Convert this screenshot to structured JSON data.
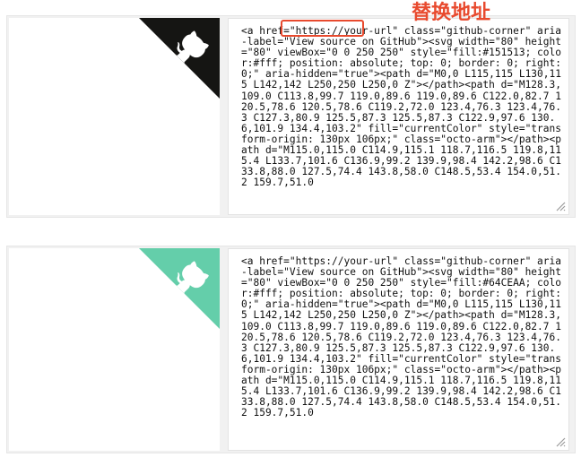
{
  "annotation": {
    "label": "替换地址",
    "color": "#e84a2e"
  },
  "examples": [
    {
      "fill_color": "#151513",
      "icon": "github-octocat-icon",
      "code": "<a href=\"https://your-url\" class=\"github-corner\" aria-label=\"View source on GitHub\"><svg width=\"80\" height=\"80\" viewBox=\"0 0 250 250\" style=\"fill:#151513; color:#fff; position: absolute; top: 0; border: 0; right: 0;\" aria-hidden=\"true\"><path d=\"M0,0 L115,115 L130,115 L142,142 L250,250 L250,0 Z\"></path><path d=\"M128.3,109.0 C113.8,99.7 119.0,89.6 119.0,89.6 C122.0,82.7 120.5,78.6 120.5,78.6 C119.2,72.0 123.4,76.3 123.4,76.3 C127.3,80.9 125.5,87.3 125.5,87.3 C122.9,97.6 130.6,101.9 134.4,103.2\" fill=\"currentColor\" style=\"transform-origin: 130px 106px;\" class=\"octo-arm\"></path><path d=\"M115.0,115.0 C114.9,115.1 118.7,116.5 119.8,115.4 L133.7,101.6 C136.9,99.2 139.9,98.4 142.2,98.6 C133.8,88.0 127.5,74.4 143.8,58.0 C148.5,53.4 154.0,51.2 159.7,51.0"
    },
    {
      "fill_color": "#64CEAA",
      "icon": "github-octocat-icon",
      "code": "<a href=\"https://your-url\" class=\"github-corner\" aria-label=\"View source on GitHub\"><svg width=\"80\" height=\"80\" viewBox=\"0 0 250 250\" style=\"fill:#64CEAA; color:#fff; position: absolute; top: 0; border: 0; right: 0;\" aria-hidden=\"true\"><path d=\"M0,0 L115,115 L130,115 L142,142 L250,250 L250,0 Z\"></path><path d=\"M128.3,109.0 C113.8,99.7 119.0,89.6 119.0,89.6 C122.0,82.7 120.5,78.6 120.5,78.6 C119.2,72.0 123.4,76.3 123.4,76.3 C127.3,80.9 125.5,87.3 125.5,87.3 C122.9,97.6 130.6,101.9 134.4,103.2\" fill=\"currentColor\" style=\"transform-origin: 130px 106px;\" class=\"octo-arm\"></path><path d=\"M115.0,115.0 C114.9,115.1 118.7,116.5 119.8,115.4 L133.7,101.6 C136.9,99.2 139.9,98.4 142.2,98.6 C133.8,88.0 127.5,74.4 143.8,58.0 C148.5,53.4 154.0,51.2 159.7,51.0"
    }
  ]
}
